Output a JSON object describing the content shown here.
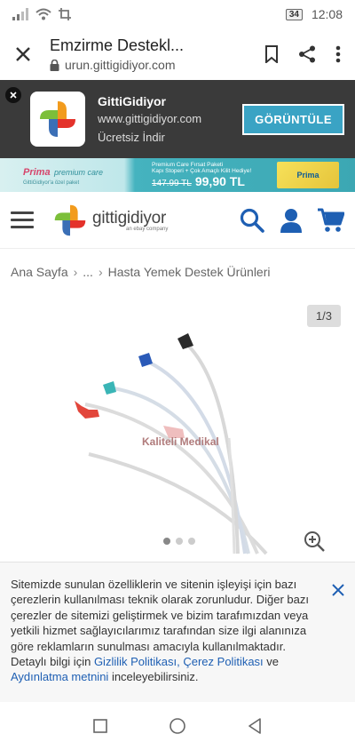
{
  "status": {
    "battery": "34",
    "time": "12:08"
  },
  "browser": {
    "title": "Emzirme Destekl...",
    "url": "urun.gittigidiyor.com"
  },
  "app_banner": {
    "name": "GittiGidiyor",
    "url": "www.gittigidiyor.com",
    "free": "Ücretsiz İndir",
    "open_label": "GÖRÜNTÜLE"
  },
  "promo": {
    "brand": "Prima",
    "brand_sub": "premium care",
    "tagline": "GittiGidiyor'a özel paket",
    "line1": "Premium Care Fırsat Paketi",
    "line2": "Kapı Stoperi + Çok Amaçlı Kilit Hediye!",
    "old_price": "147.99 TL",
    "new_price": "99,90 TL",
    "pack_label": "Prima"
  },
  "site": {
    "logo": "gittigidiyor",
    "logo_sub": "an ebay company"
  },
  "breadcrumb": {
    "home": "Ana Sayfa",
    "ellipsis": "...",
    "current": "Hasta Yemek Destek Ürünleri"
  },
  "gallery": {
    "counter": "1/3",
    "watermark": "Kaliteli Medikal"
  },
  "cookie": {
    "text": "Sitemizde sunulan özelliklerin ve sitenin işleyişi için bazı çerezlerin kullanılması teknik olarak zorunludur. Diğer bazı çerezler de sitemizi geliştirmek ve bizim tarafımızdan veya yetkili hizmet sağlayıcılarımız tarafından size ilgi alanınıza göre reklamların sunulması amacıyla kullanılmaktadır. Detaylı bilgi için ",
    "link1": "Gizlilik Politikası",
    "comma": ", ",
    "link2": "Çerez Politikası",
    "and": " ve ",
    "link3": "Aydınlatma metnini",
    "tail": " inceleyebilirsiniz."
  },
  "colors": {
    "brand_blue": "#1e5fb3",
    "banner_bg": "#3a3a3a",
    "open_btn": "#3aa3c4"
  }
}
